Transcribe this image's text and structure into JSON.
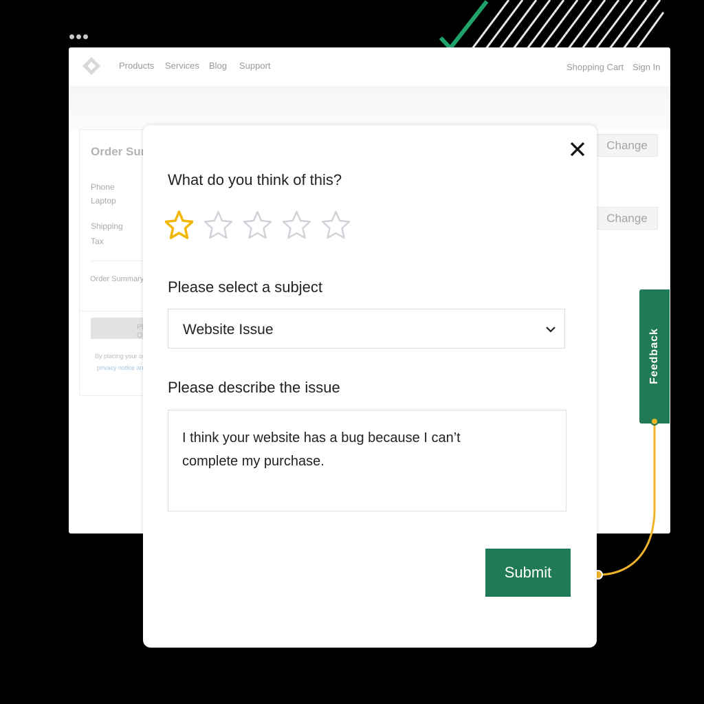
{
  "background_nav": {
    "links": [
      "Products",
      "Services",
      "Blog",
      "Support"
    ],
    "right_links": [
      "Shopping Cart",
      "Sign In"
    ]
  },
  "order_summary": {
    "title": "Order Summary",
    "item_lines": [
      "Phone",
      "Laptop"
    ],
    "charge_lines": [
      "Shipping",
      "Tax"
    ],
    "sub_label": "Order Summary",
    "button_label": "Place Order",
    "note": "By placing your order",
    "note_link": "privacy notice and"
  },
  "change_buttons": [
    "Change",
    "Change"
  ],
  "modal": {
    "rating_question": "What do you think of this?",
    "rating": 1,
    "rating_max": 5,
    "subject_label": "Please select a subject",
    "subject_value": "Website Issue",
    "description_label": "Please describe the issue",
    "description_value": "I think your website has a bug because I can’t complete my purchase.",
    "submit_label": "Submit"
  },
  "feedback_tab": {
    "label": "Feedback"
  },
  "colors": {
    "brand_green": "#1f7a55",
    "star_active": "#f2b705",
    "star_inactive": "#cfd2d8",
    "connector": "#f0b429",
    "check": "#1fa36a"
  },
  "icons": [
    "logo-icon",
    "close-icon",
    "star-icon",
    "chevron-down-icon",
    "check-icon"
  ]
}
